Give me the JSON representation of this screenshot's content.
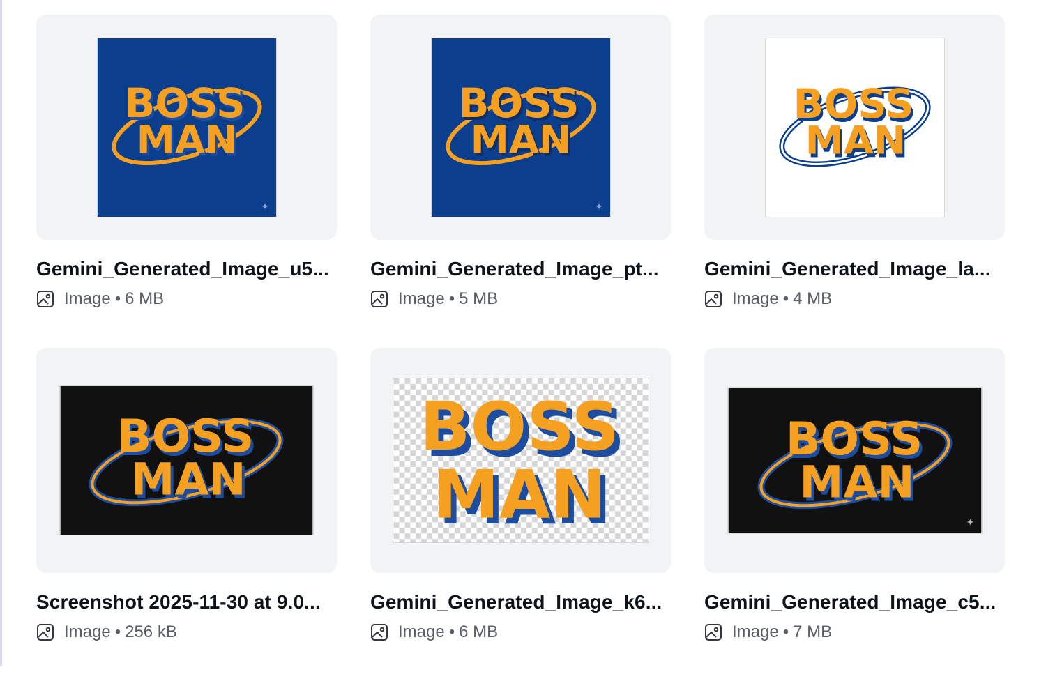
{
  "colors": {
    "navy": "#0b3f8e",
    "orange": "#f5a020",
    "dark_blue": "#1c4da0",
    "black_bg": "#111111",
    "white_bg": "#ffffff",
    "card_bg": "#f2f3f5"
  },
  "logo_text": {
    "line1": "BOSS",
    "line2": "MAN"
  },
  "files": [
    {
      "title": "Gemini_Generated_Image_u5...",
      "type": "Image",
      "sep": "•",
      "size": "6 MB",
      "bg": "navy"
    },
    {
      "title": "Gemini_Generated_Image_pt...",
      "type": "Image",
      "sep": "•",
      "size": "5 MB",
      "bg": "navy"
    },
    {
      "title": "Gemini_Generated_Image_la...",
      "type": "Image",
      "sep": "•",
      "size": "4 MB",
      "bg": "white"
    },
    {
      "title": "Screenshot 2025-11-30 at 9.0...",
      "type": "Image",
      "sep": "•",
      "size": "256 kB",
      "bg": "black"
    },
    {
      "title": "Gemini_Generated_Image_k6...",
      "type": "Image",
      "sep": "•",
      "size": "6 MB",
      "bg": "transparent"
    },
    {
      "title": "Gemini_Generated_Image_c5...",
      "type": "Image",
      "sep": "•",
      "size": "7 MB",
      "bg": "black"
    }
  ]
}
